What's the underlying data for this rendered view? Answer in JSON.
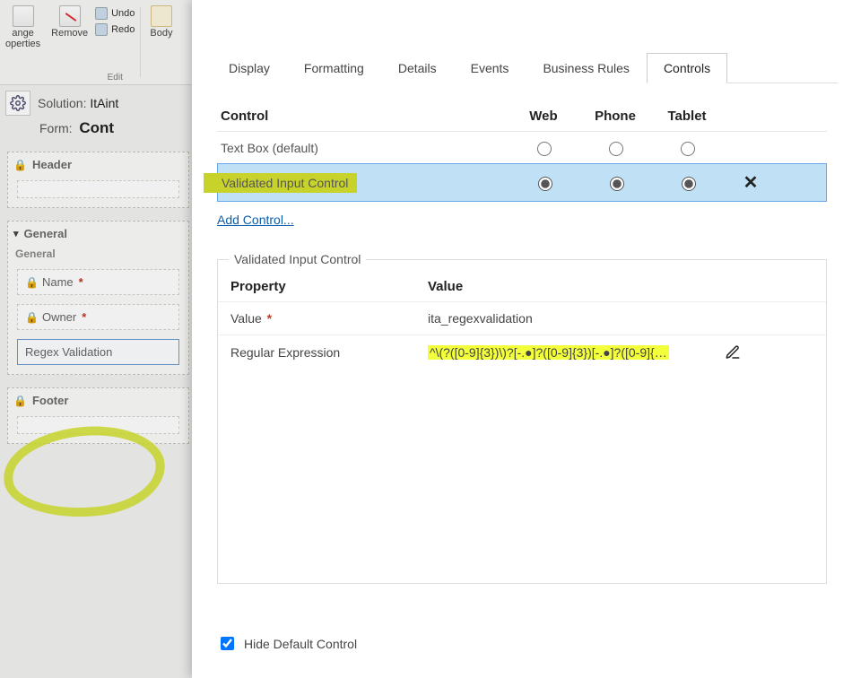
{
  "ribbon": {
    "change_props": "ange\noperties",
    "remove": "Remove",
    "undo": "Undo",
    "redo": "Redo",
    "body": "Body",
    "group_edit": "Edit"
  },
  "solution": {
    "label": "Solution:",
    "name": "ItAint"
  },
  "form": {
    "label": "Form:",
    "name": "Cont"
  },
  "sections": {
    "header": "Header",
    "general": "General",
    "general_sub": "General",
    "footer": "Footer",
    "fields": {
      "name": "Name",
      "owner": "Owner",
      "regex": "Regex Validation"
    }
  },
  "tabs": [
    "Display",
    "Formatting",
    "Details",
    "Events",
    "Business Rules",
    "Controls"
  ],
  "active_tab": "Controls",
  "grid": {
    "col_control": "Control",
    "col_web": "Web",
    "col_phone": "Phone",
    "col_tablet": "Tablet",
    "rows": [
      {
        "name": "Text Box (default)",
        "web": false,
        "phone": false,
        "tablet": false,
        "removable": false
      },
      {
        "name": "Validated Input Control",
        "web": true,
        "phone": true,
        "tablet": true,
        "removable": true
      }
    ],
    "add": "Add Control..."
  },
  "props": {
    "legend": "Validated Input Control",
    "col_property": "Property",
    "col_value": "Value",
    "rows": [
      {
        "name": "Value",
        "required": true,
        "value": "ita_regexvalidation",
        "editable": false
      },
      {
        "name": "Regular Expression",
        "required": false,
        "value": "^\\(?([0-9]{3})\\)?[-.●]?([0-9]{3})[-.●]?([0-9]{…",
        "editable": true
      }
    ]
  },
  "hide_default": {
    "label": "Hide Default Control",
    "checked": true
  }
}
